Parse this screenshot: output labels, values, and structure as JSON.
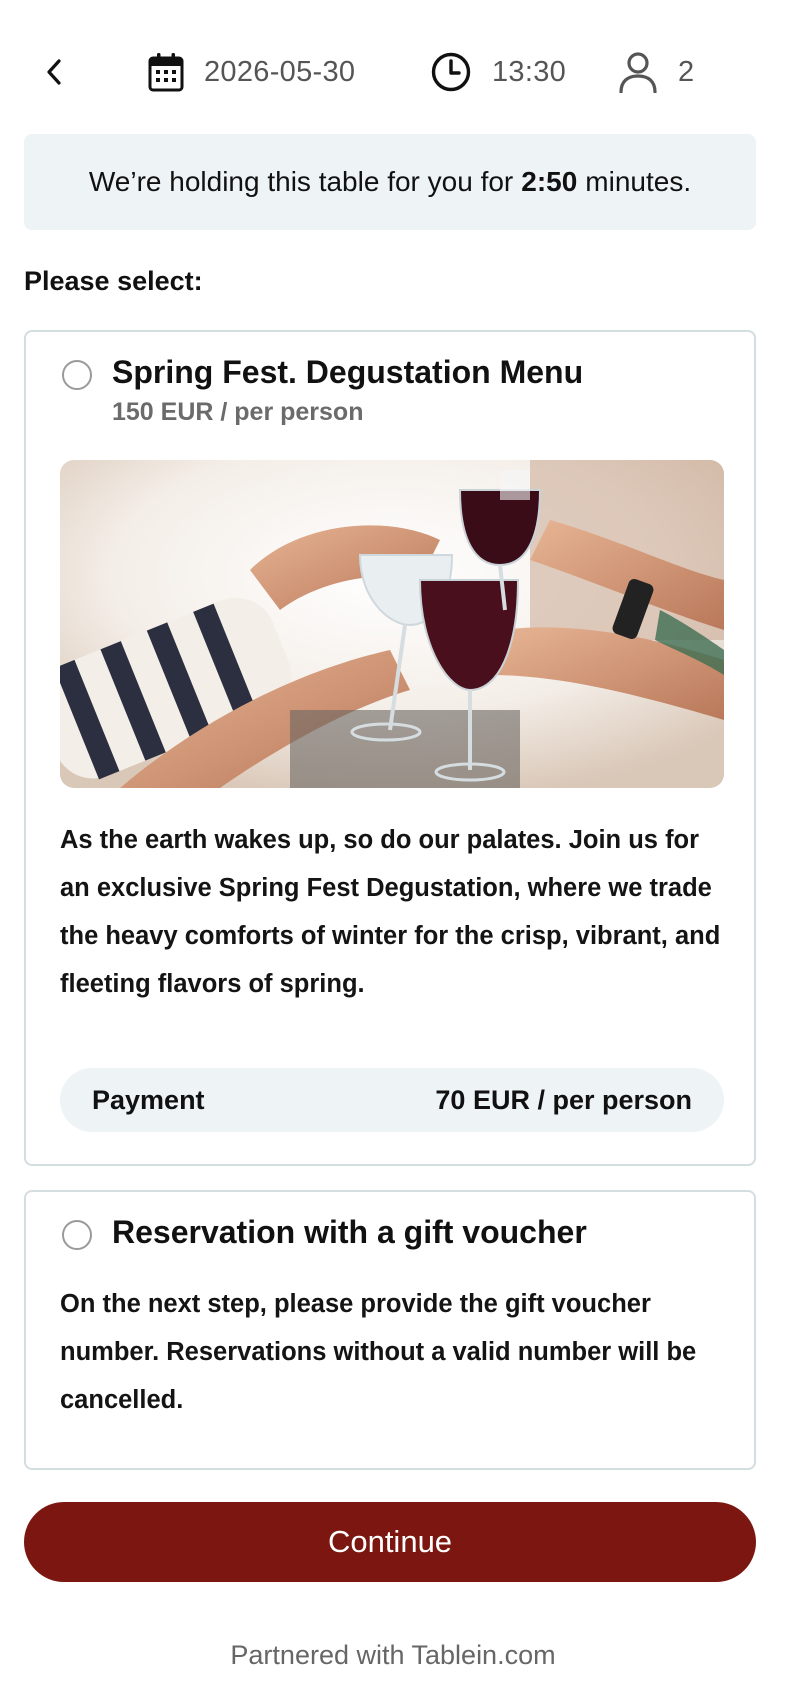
{
  "header": {
    "date": "2026-05-30",
    "time": "13:30",
    "guests": "2",
    "icons": [
      "chevron-left-icon",
      "calendar-icon",
      "clock-icon",
      "person-icon"
    ]
  },
  "hold_banner": {
    "prefix": "We’re holding this table for you for",
    "countdown": "2:50",
    "suffix": "minutes."
  },
  "select_label": "Please select:",
  "options": [
    {
      "title": "Spring Fest. Degustation Menu",
      "price": "150 EUR / per person",
      "image": "wine-toast-photo",
      "description": "As the earth wakes up, so do our palates. Join us for an exclusive Spring Fest Degustation, where we trade the heavy comforts of winter for the crisp, vibrant, and fleeting flavors of spring.",
      "payment_label": "Payment",
      "payment_value": "70 EUR / per person",
      "selected": false
    },
    {
      "title": "Reservation with a gift voucher",
      "description": "On the next step, please provide the gift voucher number. Reservations without a valid number will be cancelled.",
      "selected": false
    }
  ],
  "continue_label": "Continue",
  "footer": {
    "prefix": "Partnered with",
    "brand": "Tablein.com"
  },
  "colors": {
    "accent": "#7b1710",
    "banner_bg": "#eef4f6",
    "card_border": "#d4dde0",
    "muted_text": "#6b6b6b"
  }
}
